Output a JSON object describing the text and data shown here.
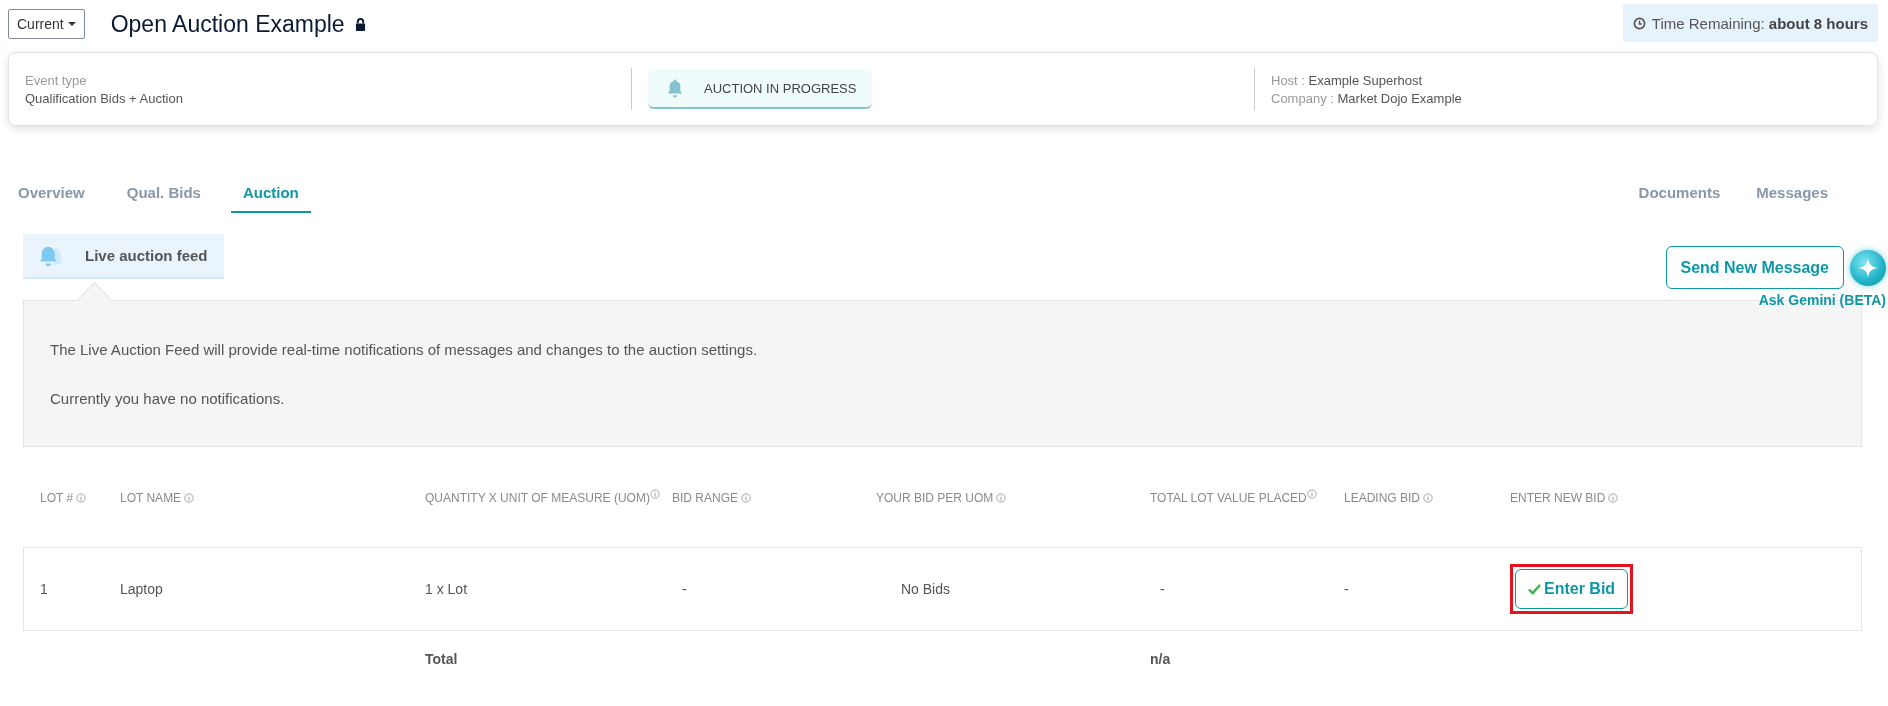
{
  "version_dropdown": {
    "label": "Current"
  },
  "title": "Open Auction Example",
  "locked": true,
  "time_remaining": {
    "label": "Time Remaining:",
    "value": "about 8 hours"
  },
  "event_card": {
    "event_type_label": "Event type",
    "event_type": "Qualification Bids + Auction",
    "status": "AUCTION IN PROGRESS",
    "host_label": "Host :",
    "host": "Example Superhost",
    "company_label": "Company :",
    "company": "Market Dojo Example"
  },
  "tabs": [
    {
      "label": "Overview",
      "selected": false
    },
    {
      "label": "Qual. Bids",
      "selected": false
    },
    {
      "label": "Auction",
      "selected": true
    }
  ],
  "right_tabs": [
    {
      "label": "Documents",
      "selected": false
    },
    {
      "label": "Messages",
      "selected": false
    }
  ],
  "feed_tab": {
    "label": "Live auction feed"
  },
  "send_button": {
    "label": "Send New Message"
  },
  "assistant": {
    "label": "Ask Gemini (BETA)"
  },
  "feed": {
    "messages": [
      "The Live Auction Feed will provide real-time notifications of messages and changes to the auction settings.",
      "Currently you have no notifications."
    ]
  },
  "table": {
    "columns": [
      {
        "label": "LOT #",
        "info": true
      },
      {
        "label": "LOT NAME",
        "info": true
      },
      {
        "label": "QUANTITY X UNIT OF MEASURE (UOM)",
        "info": true
      },
      {
        "label": "BID RANGE",
        "info": true
      },
      {
        "label": "YOUR BID PER UOM",
        "info": true
      },
      {
        "label": "TOTAL LOT VALUE PLACED",
        "info": true
      },
      {
        "label": "LEADING BID",
        "info": true
      },
      {
        "label": "ENTER NEW BID",
        "info": true
      }
    ],
    "rows": [
      {
        "cells": [
          "1",
          "Laptop",
          "1 x Lot",
          "-",
          "No Bids",
          "-",
          "-"
        ],
        "action": {
          "label": "Enter Bid",
          "highlighted": true
        }
      }
    ],
    "total": {
      "label": "Total",
      "value": "n/a"
    }
  }
}
